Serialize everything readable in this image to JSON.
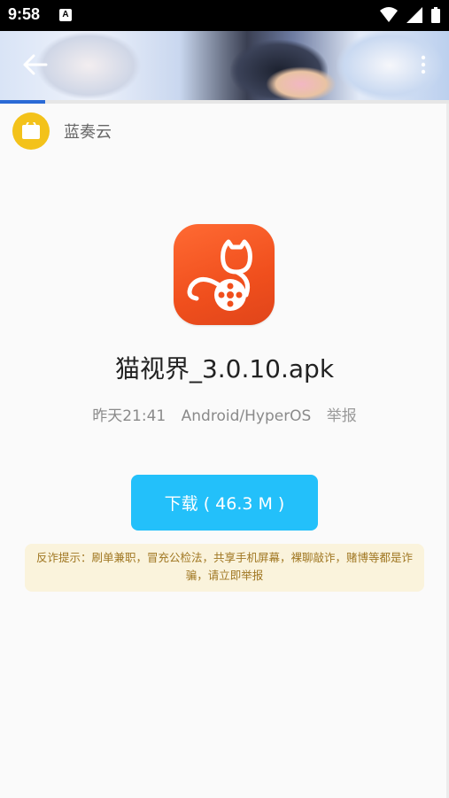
{
  "status_bar": {
    "time": "9:58",
    "notification_icon": "A"
  },
  "banner": {
    "image_name": "anime-banner-image"
  },
  "site": {
    "name": "蓝奏云"
  },
  "loading": {
    "progress": 0.1
  },
  "file": {
    "name": "猫视界_3.0.10.apk",
    "date": "昨天21:41",
    "platform": "Android/HyperOS",
    "report_label": "举报"
  },
  "download": {
    "label": "下载 ( 46.3 M )"
  },
  "warning": {
    "text": "反诈提示：刷单兼职，冒充公检法，共享手机屏幕，裸聊敲诈，赌博等都是诈骗，请立即举报"
  },
  "colors": {
    "download_button": "#23c0fa",
    "app_icon": "#f04f1d",
    "site_logo": "#f3c21a",
    "warning_bg": "#faf3dc",
    "progress": "#2a6ad6"
  }
}
